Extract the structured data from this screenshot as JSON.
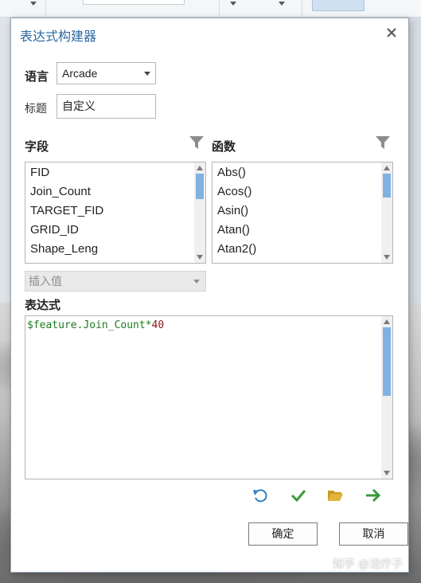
{
  "dialog": {
    "title": "表达式构建器",
    "close_icon": "close-icon"
  },
  "language": {
    "label": "语言",
    "value": "Arcade"
  },
  "title_field": {
    "label": "标题",
    "value": "自定义"
  },
  "fields": {
    "header": "字段",
    "filter_icon": "funnel-icon",
    "items": [
      "FID",
      "Join_Count",
      "TARGET_FID",
      "GRID_ID",
      "Shape_Leng"
    ]
  },
  "functions": {
    "header": "函数",
    "filter_icon": "funnel-icon",
    "items": [
      "Abs()",
      "Acos()",
      "Asin()",
      "Atan()",
      "Atan2()"
    ]
  },
  "insert_values": {
    "placeholder": "插入值"
  },
  "expression": {
    "header": "表达式",
    "code_var": "$feature.Join_Count*",
    "code_num": "40"
  },
  "toolbar": {
    "icons": [
      "undo-icon",
      "verify-check-icon",
      "open-folder-icon",
      "arrow-right-icon"
    ],
    "colors": {
      "blue": "#2f7fc0",
      "green": "#3a9b3a",
      "folder": "#e0b53a"
    }
  },
  "buttons": {
    "ok": "确定",
    "cancel": "取消"
  },
  "watermark": "知乎 @没疗子"
}
